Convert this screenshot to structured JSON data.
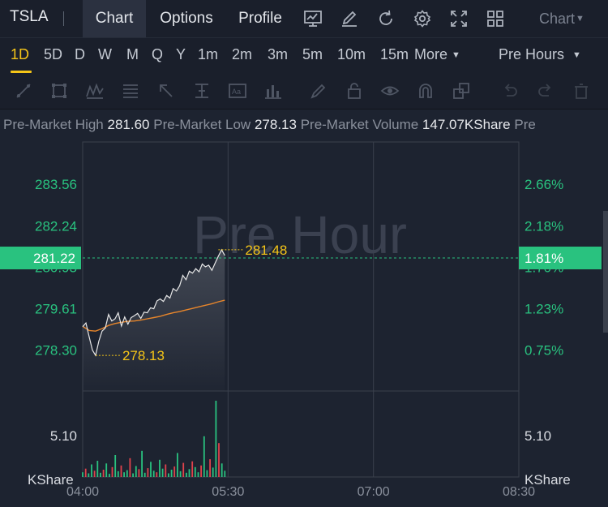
{
  "header": {
    "ticker": "TSLA",
    "tabs": [
      {
        "label": "Chart",
        "active": true
      },
      {
        "label": "Options",
        "active": false
      },
      {
        "label": "Profile",
        "active": false
      }
    ],
    "icons": [
      "chart-monitor-icon",
      "pen-edit-icon",
      "refresh-icon",
      "gear-icon",
      "fullscreen-icon",
      "grid-layout-icon"
    ],
    "chart_dropdown": "Chart"
  },
  "periods": {
    "items": [
      "1D",
      "5D",
      "D",
      "W",
      "M",
      "Q",
      "Y",
      "1m",
      "2m",
      "3m",
      "5m",
      "10m",
      "15m"
    ],
    "active": "1D",
    "more": "More",
    "session": "Pre Hours"
  },
  "drawing_tools": [
    "line-tool-icon",
    "rectangle-tool-icon",
    "pattern-tool-icon",
    "fibonacci-tool-icon",
    "arrow-tool-icon",
    "measure-tool-icon",
    "text-tool-icon",
    "bar-pattern-icon",
    "brush-icon",
    "lock-icon",
    "eye-icon",
    "magnet-icon",
    "layers-icon",
    "undo-icon",
    "trash-icon"
  ],
  "stats": [
    {
      "label": "Pre-Market High",
      "value": "281.60"
    },
    {
      "label": "Pre-Market Low",
      "value": "278.13"
    },
    {
      "label": "Pre-Market Volume",
      "value": "147.07KShare"
    },
    {
      "label": "Pre",
      "value": ""
    }
  ],
  "watermark": "Pre Hour",
  "colors": {
    "up": "#29c27f",
    "down": "#e0434c",
    "accent": "#f5c518",
    "average": "#e8862b",
    "price": "#e8e8e8"
  },
  "chart_data": {
    "type": "line",
    "x_ticks": [
      "04:00",
      "05:30",
      "07:00",
      "08:30"
    ],
    "x_range_minutes": [
      0,
      270
    ],
    "y_ticks": [
      "283.56",
      "282.24",
      "280.93",
      "279.61",
      "278.30"
    ],
    "y_range": [
      277.0,
      284.9
    ],
    "pct_ticks": [
      "2.66%",
      "2.18%",
      "1.70%",
      "1.23%",
      "0.75%"
    ],
    "current_price": "281.22",
    "current_pct": "1.81%",
    "high_label": "281.48",
    "low_label": "278.13",
    "high_marker": {
      "minute": 84,
      "value": 281.48
    },
    "low_marker": {
      "minute": 8,
      "value": 278.13
    },
    "series": [
      {
        "values_minute": [
          0,
          2,
          4,
          6,
          8,
          10,
          12,
          14,
          16,
          18,
          20,
          22,
          24,
          26,
          28,
          30,
          32,
          34,
          36,
          38,
          40,
          42,
          44,
          46,
          48,
          50,
          52,
          54,
          56,
          58,
          60,
          62,
          64,
          66,
          68,
          70,
          72,
          74,
          76,
          78,
          80,
          82,
          84,
          86,
          88
        ],
        "values": [
          279.04,
          279.16,
          278.72,
          278.3,
          278.13,
          278.58,
          278.9,
          279.0,
          279.43,
          279.22,
          279.29,
          279.48,
          279.06,
          279.35,
          279.12,
          279.33,
          279.39,
          279.46,
          279.3,
          279.5,
          279.48,
          279.64,
          279.61,
          279.86,
          279.92,
          279.84,
          280.03,
          279.95,
          280.25,
          280.17,
          280.34,
          280.67,
          280.53,
          280.8,
          280.74,
          280.88,
          280.78,
          281.03,
          280.94,
          280.99,
          280.83,
          281.06,
          281.28,
          281.48,
          281.3
        ]
      },
      {
        "values_minute": [
          0,
          4,
          8,
          12,
          16,
          20,
          24,
          28,
          32,
          36,
          40,
          44,
          48,
          52,
          56,
          60,
          64,
          68,
          72,
          76,
          80,
          84,
          88
        ],
        "values": [
          279.05,
          278.92,
          278.9,
          278.98,
          279.08,
          279.14,
          279.18,
          279.21,
          279.22,
          279.25,
          279.29,
          279.33,
          279.37,
          279.43,
          279.48,
          279.52,
          279.57,
          279.62,
          279.67,
          279.72,
          279.77,
          279.83,
          279.88
        ]
      }
    ],
    "volume": {
      "tick": "5.10",
      "max": 14.6,
      "unit": "KShare",
      "bars": [
        0.9,
        1.6,
        0.7,
        2.4,
        1.2,
        3.1,
        0.8,
        1.4,
        2.6,
        0.6,
        1.9,
        4.2,
        1.1,
        2.2,
        0.9,
        1.3,
        3.6,
        0.7,
        2.1,
        1.5,
        5.0,
        0.8,
        1.7,
        2.9,
        1.2,
        0.9,
        3.3,
        1.6,
        2.4,
        0.7,
        1.4,
        2.0,
        4.6,
        1.1,
        2.7,
        0.8,
        1.5,
        3.0,
        1.9,
        0.9,
        2.2,
        7.8,
        1.3,
        3.4,
        1.8,
        14.6,
        6.5,
        2.6,
        1.2
      ]
    }
  }
}
